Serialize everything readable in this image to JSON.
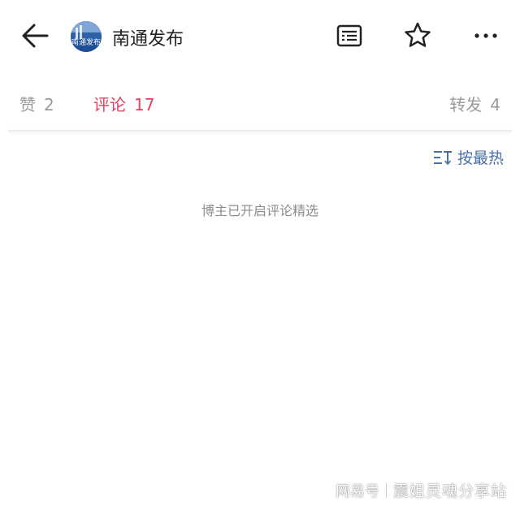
{
  "header": {
    "account_name": "南通发布",
    "avatar_text": "南通发布",
    "icons": [
      "back-arrow-icon",
      "article-list-icon",
      "star-icon",
      "more-icon"
    ]
  },
  "tabs": [
    {
      "label": "赞",
      "count": "2",
      "active": false
    },
    {
      "label": "评论",
      "count": "17",
      "active": true
    },
    {
      "label": "转发",
      "count": "4",
      "active": false
    }
  ],
  "sort": {
    "label": "按最热",
    "icon": "sort-icon"
  },
  "notice": "博主已开启评论精选",
  "watermark": {
    "brand": "网易号",
    "site": "震姐灵魂分享站"
  },
  "colors": {
    "accent": "#e0405b",
    "link": "#4a6fa5",
    "muted": "#9a9a9a",
    "avatar_bg": "#2e62a8"
  }
}
